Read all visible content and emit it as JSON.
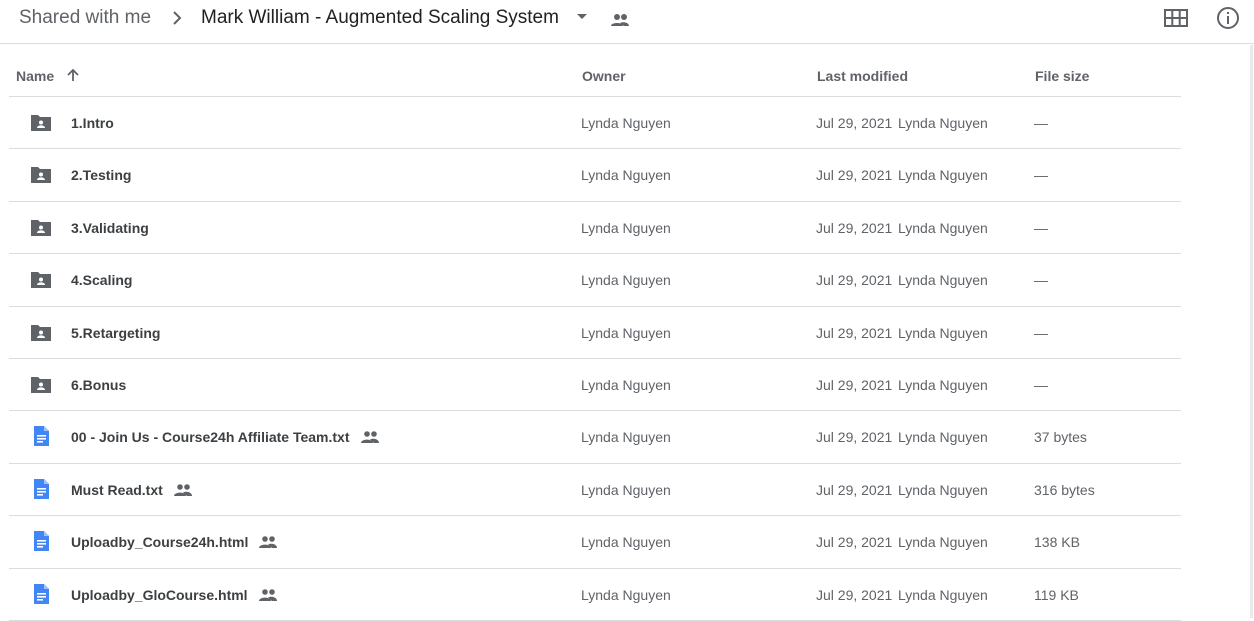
{
  "breadcrumb": {
    "root": "Shared with me",
    "current": "Mark William - Augmented Scaling System"
  },
  "columns": {
    "name": "Name",
    "owner": "Owner",
    "last_modified": "Last modified",
    "file_size": "File size"
  },
  "icons": {
    "folder": "shared-folder-icon",
    "doc": "google-doc-icon",
    "shared": "people-icon",
    "view_toggle": "grid-view-icon",
    "info": "info-icon",
    "sort": "arrow-up-icon"
  },
  "colors": {
    "folder": "#5f6368",
    "doc": "#4285f4"
  },
  "rows": [
    {
      "name": "1.Intro",
      "type": "folder",
      "owner": "Lynda Nguyen",
      "date": "Jul 29, 2021",
      "modified_by": "Lynda Nguyen",
      "size": "—"
    },
    {
      "name": "2.Testing",
      "type": "folder",
      "owner": "Lynda Nguyen",
      "date": "Jul 29, 2021",
      "modified_by": "Lynda Nguyen",
      "size": "—"
    },
    {
      "name": "3.Validating",
      "type": "folder",
      "owner": "Lynda Nguyen",
      "date": "Jul 29, 2021",
      "modified_by": "Lynda Nguyen",
      "size": "—"
    },
    {
      "name": "4.Scaling",
      "type": "folder",
      "owner": "Lynda Nguyen",
      "date": "Jul 29, 2021",
      "modified_by": "Lynda Nguyen",
      "size": "—"
    },
    {
      "name": "5.Retargeting",
      "type": "folder",
      "owner": "Lynda Nguyen",
      "date": "Jul 29, 2021",
      "modified_by": "Lynda Nguyen",
      "size": "—"
    },
    {
      "name": "6.Bonus",
      "type": "folder",
      "owner": "Lynda Nguyen",
      "date": "Jul 29, 2021",
      "modified_by": "Lynda Nguyen",
      "size": "—"
    },
    {
      "name": "00 - Join Us - Course24h Affiliate Team.txt",
      "type": "doc",
      "shared": true,
      "owner": "Lynda Nguyen",
      "date": "Jul 29, 2021",
      "modified_by": "Lynda Nguyen",
      "size": "37 bytes"
    },
    {
      "name": "Must Read.txt",
      "type": "doc",
      "shared": true,
      "owner": "Lynda Nguyen",
      "date": "Jul 29, 2021",
      "modified_by": "Lynda Nguyen",
      "size": "316 bytes"
    },
    {
      "name": "Uploadby_Course24h.html",
      "type": "doc",
      "shared": true,
      "owner": "Lynda Nguyen",
      "date": "Jul 29, 2021",
      "modified_by": "Lynda Nguyen",
      "size": "138 KB"
    },
    {
      "name": "Uploadby_GloCourse.html",
      "type": "doc",
      "shared": true,
      "owner": "Lynda Nguyen",
      "date": "Jul 29, 2021",
      "modified_by": "Lynda Nguyen",
      "size": "119 KB"
    }
  ]
}
